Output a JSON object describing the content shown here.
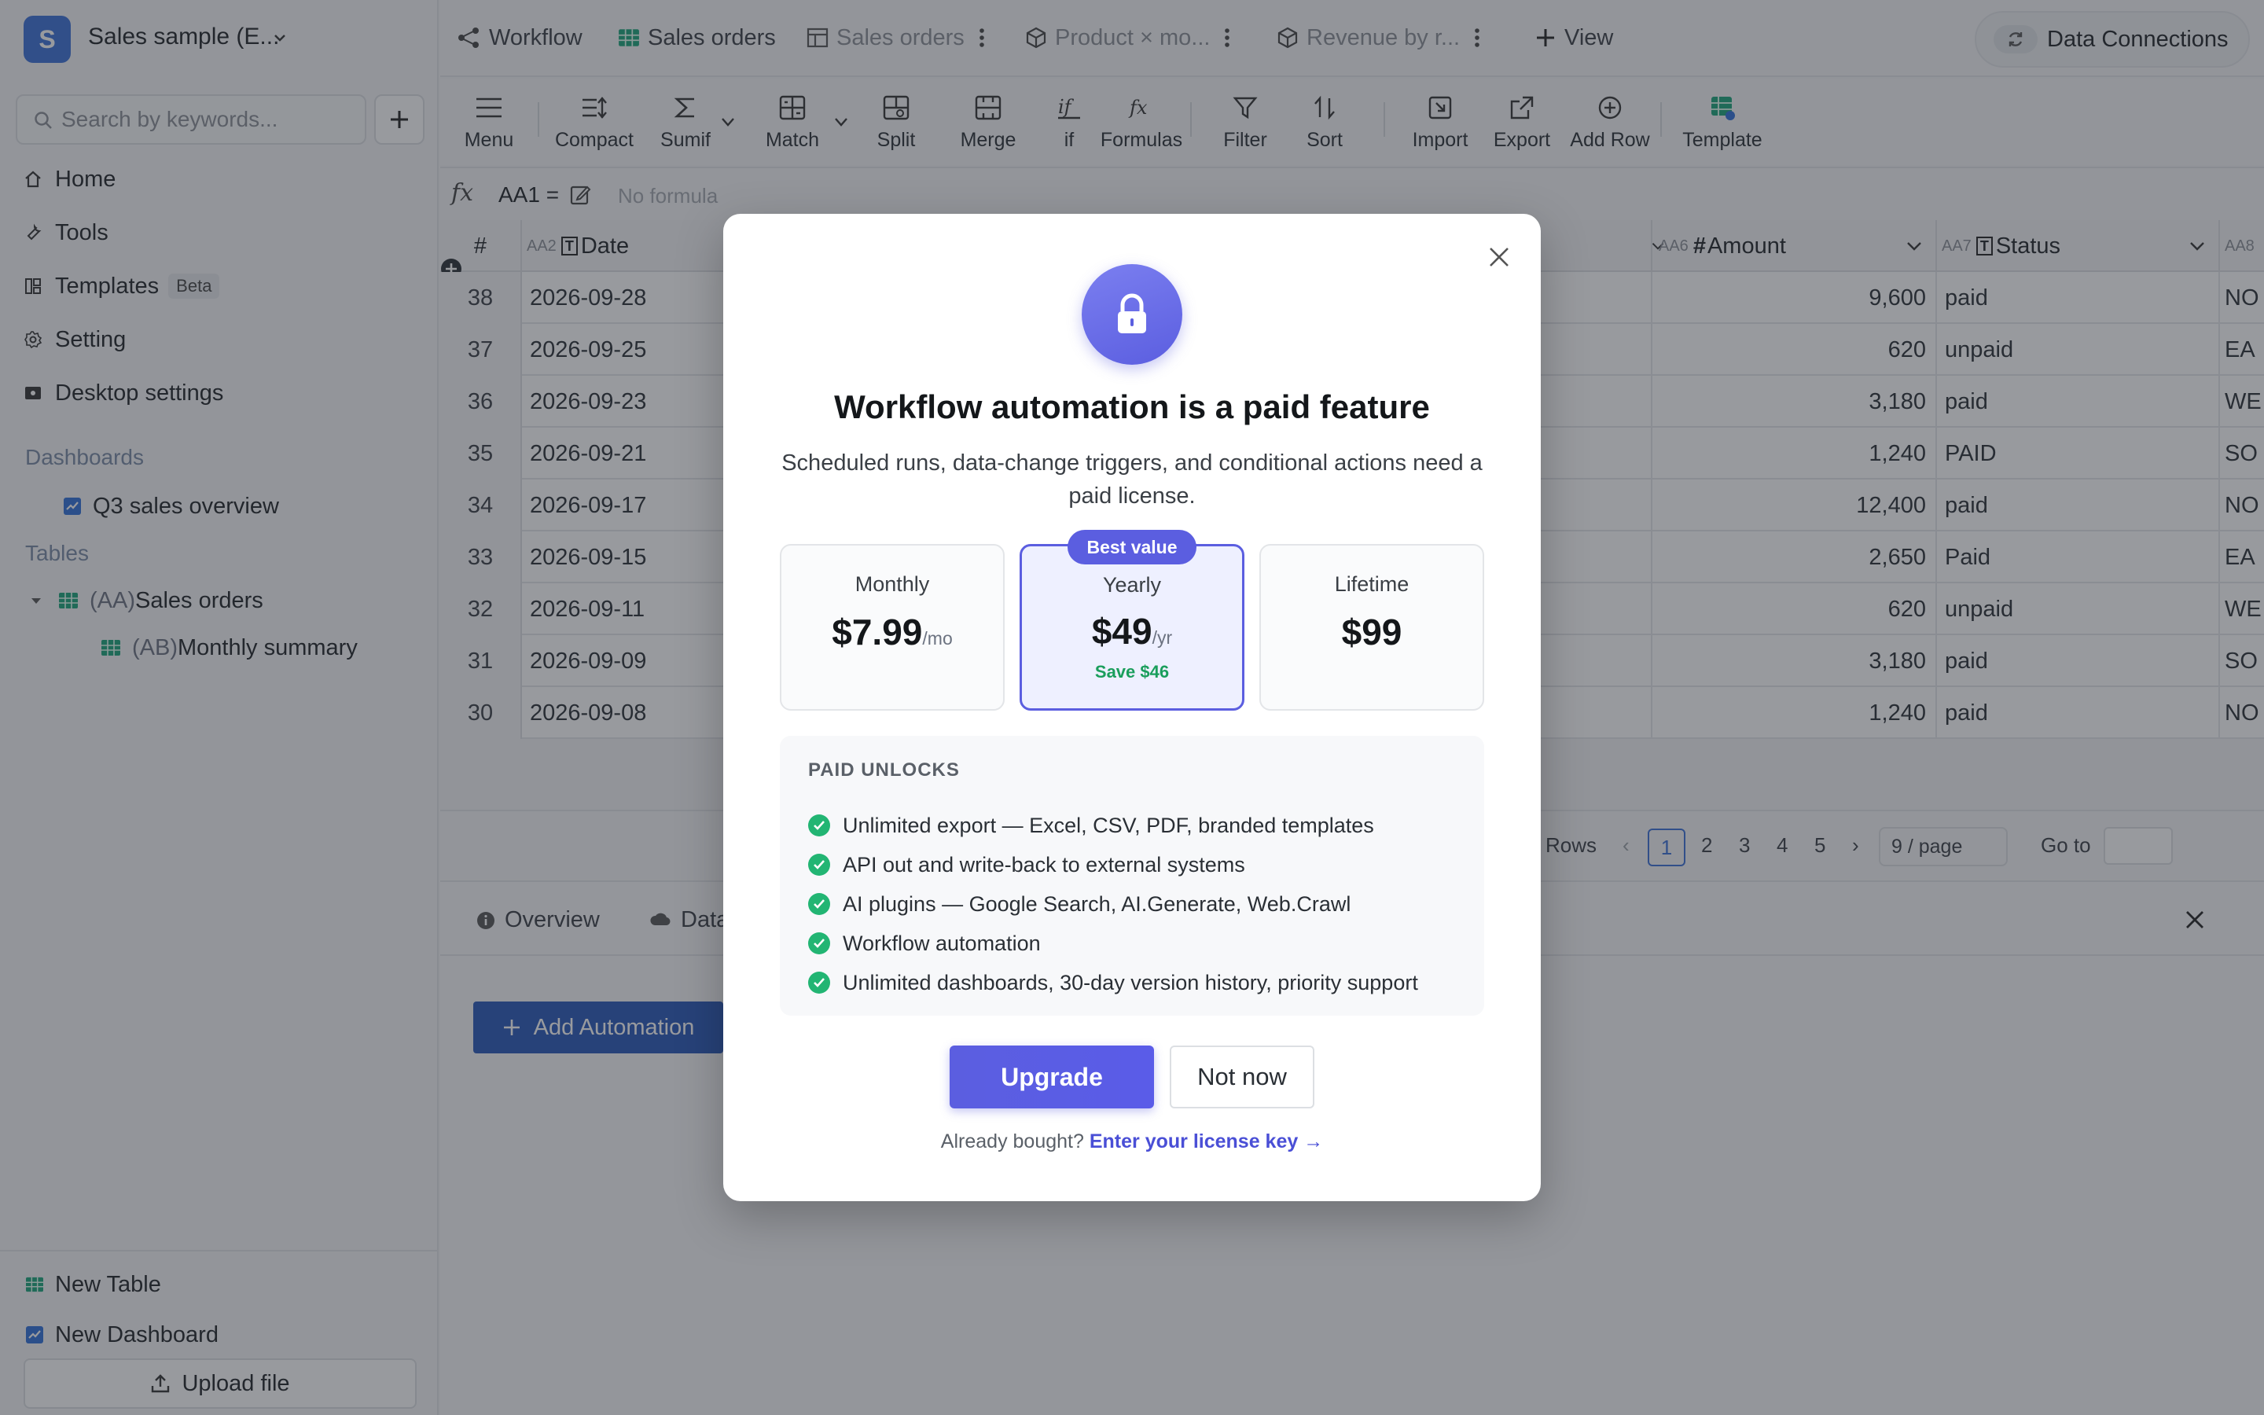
{
  "workspace": {
    "avatar_letter": "S",
    "name": "Sales sample (E..."
  },
  "sidebar": {
    "search_placeholder": "Search by keywords...",
    "nav": [
      {
        "label": "Home",
        "icon": "home-icon"
      },
      {
        "label": "Tools",
        "icon": "wrench-icon"
      },
      {
        "label": "Templates",
        "icon": "template-icon",
        "badge": "Beta"
      },
      {
        "label": "Setting",
        "icon": "gear-icon"
      },
      {
        "label": "Desktop settings",
        "icon": "desktop-settings-icon"
      }
    ],
    "dashboards_label": "Dashboards",
    "dashboards": [
      {
        "label": "Q3 sales overview"
      }
    ],
    "tables_label": "Tables",
    "tables": [
      {
        "prefix": "(AA)",
        "label": "Sales orders"
      },
      {
        "prefix": "(AB)",
        "label": "Monthly summary"
      }
    ],
    "new_table": "New Table",
    "new_dashboard": "New Dashboard",
    "upload": "Upload file"
  },
  "tabs": [
    {
      "label": "Workflow",
      "active": true
    },
    {
      "label": "Sales orders",
      "active": true
    },
    {
      "label": "Sales orders",
      "active": false
    },
    {
      "label": "Product × mo...",
      "active": false
    },
    {
      "label": "Revenue by r...",
      "active": false
    }
  ],
  "add_view": "View",
  "data_connections": "Data Connections",
  "toolbar": [
    "Menu",
    "Compact",
    "Sumif",
    "Match",
    "Split",
    "Merge",
    "if",
    "Formulas",
    "Filter",
    "Sort",
    "Import",
    "Export",
    "Add Row",
    "Template"
  ],
  "formula": {
    "ref": "AA1 =",
    "placeholder": "No formula"
  },
  "grid": {
    "headers": {
      "rownum": "#",
      "date": {
        "code": "AA2",
        "type": "T",
        "label": "Date"
      },
      "amount": {
        "code": "AA6",
        "type": "#",
        "label": "Amount"
      },
      "status": {
        "code": "AA7",
        "type": "T",
        "label": "Status"
      },
      "region": {
        "code": "AA8"
      }
    },
    "rows": [
      {
        "n": "38",
        "date": "2026-09-28",
        "amount": "9,600",
        "status": "paid",
        "region": "NO"
      },
      {
        "n": "37",
        "date": "2026-09-25",
        "amount": "620",
        "status": "unpaid",
        "region": "EA"
      },
      {
        "n": "36",
        "date": "2026-09-23",
        "amount": "3,180",
        "status": "paid",
        "region": "WE"
      },
      {
        "n": "35",
        "date": "2026-09-21",
        "amount": "1,240",
        "status": "PAID",
        "region": "SO"
      },
      {
        "n": "34",
        "date": "2026-09-17",
        "amount": "12,400",
        "status": "paid",
        "region": "NO"
      },
      {
        "n": "33",
        "date": "2026-09-15",
        "amount": "2,650",
        "status": "Paid",
        "region": "EA"
      },
      {
        "n": "32",
        "date": "2026-09-11",
        "amount": "620",
        "status": "unpaid",
        "region": "WE"
      },
      {
        "n": "31",
        "date": "2026-09-09",
        "amount": "3,180",
        "status": "paid",
        "region": "SO"
      },
      {
        "n": "30",
        "date": "2026-09-08",
        "amount": "1,240",
        "status": "paid",
        "region": "NO"
      }
    ]
  },
  "pager": {
    "rows_label": "Rows",
    "pages": [
      "1",
      "2",
      "3",
      "4",
      "5"
    ],
    "page_size": "9 / page",
    "goto": "Go to"
  },
  "panel": {
    "tab_overview": "Overview",
    "tab_data": "Data",
    "add_automation": "Add Automation"
  },
  "modal": {
    "title": "Workflow automation is a paid feature",
    "subtitle": "Scheduled runs, data-change triggers, and conditional actions need a paid license.",
    "plans": [
      {
        "name": "Monthly",
        "price": "$7.99",
        "unit": "/mo"
      },
      {
        "name": "Yearly",
        "price": "$49",
        "unit": "/yr",
        "save": "Save $46",
        "badge": "Best value",
        "selected": true
      },
      {
        "name": "Lifetime",
        "price": "$99"
      }
    ],
    "unlocks_heading": "PAID UNLOCKS",
    "unlocks": [
      "Unlimited export — Excel, CSV, PDF, branded templates",
      "API out and write-back to external systems",
      "AI plugins — Google Search, AI.Generate, Web.Crawl",
      "Workflow automation",
      "Unlimited dashboards, 30-day version history, priority support"
    ],
    "upgrade": "Upgrade",
    "not_now": "Not now",
    "footer_text": "Already bought?",
    "footer_link": "Enter your license key →"
  },
  "colors": {
    "accent": "#5b5ee0",
    "primary_blue": "#2857b8",
    "success": "#22b573"
  }
}
